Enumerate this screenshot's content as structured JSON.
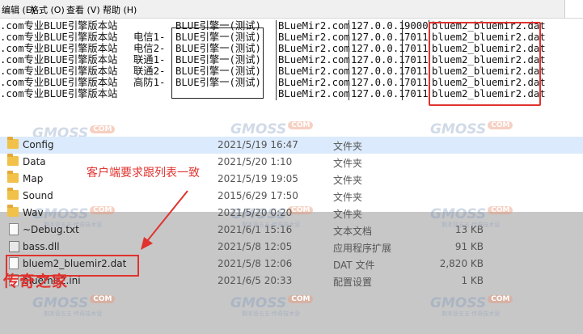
{
  "menu": {
    "items": [
      "编辑 (E)",
      "格式 (O)",
      "查看 (V)",
      "帮助 (H)"
    ]
  },
  "server_list": {
    "rows": [
      {
        "site": ".com专业BLUE引擎版本站",
        "line": "",
        "engine": "BLUE引擎一(测试)",
        "domain": "BLueMir2.com",
        "ip": "127.0.0.1",
        "port": "9000",
        "file": "bluem2_bluemir2.dat"
      },
      {
        "site": ".com专业BLUE引擎版本站",
        "line": "电信1-",
        "engine": "BLUE引擎一(测试)",
        "domain": "BLueMir2.com",
        "ip": "127.0.0.1",
        "port": "7011",
        "file": "bluem2_bluemir2.dat"
      },
      {
        "site": ".com专业BLUE引擎版本站",
        "line": "电信2-",
        "engine": "BLUE引擎一(测试)",
        "domain": "BLueMir2.com",
        "ip": "127.0.0.1",
        "port": "7011",
        "file": "bluem2_bluemir2.dat"
      },
      {
        "site": ".com专业BLUE引擎版本站",
        "line": "联通1-",
        "engine": "BLUE引擎一(测试)",
        "domain": "BLueMir2.com",
        "ip": "127.0.0.1",
        "port": "7011",
        "file": "bluem2_bluemir2.dat"
      },
      {
        "site": ".com专业BLUE引擎版本站",
        "line": "联通2-",
        "engine": "BLUE引擎一(测试)",
        "domain": "BLueMir2.com",
        "ip": "127.0.0.1",
        "port": "7011",
        "file": "bluem2_bluemir2.dat"
      },
      {
        "site": ".com专业BLUE引擎版本站",
        "line": "高防1-",
        "engine": "BLUE引擎一(测试)",
        "domain": "BLueMir2.com",
        "ip": "127.0.0.1",
        "port": "7011",
        "file": "bluem2_bluemir2.dat"
      },
      {
        "site": ".com专业BLUE引擎版本站",
        "line": "",
        "engine": "",
        "domain": "BLueMir2.com",
        "ip": "127.0.0.1",
        "port": "7011",
        "file": "bluem2_bluemir2.dat"
      }
    ]
  },
  "files": [
    {
      "name": "Config",
      "date": "2021/5/19 16:47",
      "type": "文件夹",
      "size": "",
      "icon": "folder-icon",
      "selected": true
    },
    {
      "name": "Data",
      "date": "2021/5/20 1:10",
      "type": "文件夹",
      "size": "",
      "icon": "folder-icon",
      "selected": false
    },
    {
      "name": "Map",
      "date": "2021/5/19 19:05",
      "type": "文件夹",
      "size": "",
      "icon": "folder-icon",
      "selected": false
    },
    {
      "name": "Sound",
      "date": "2015/6/29 17:50",
      "type": "文件夹",
      "size": "",
      "icon": "folder-icon",
      "selected": false
    },
    {
      "name": "Wav",
      "date": "2021/5/20 0:20",
      "type": "文件夹",
      "size": "",
      "icon": "folder-icon",
      "selected": false
    },
    {
      "name": "~Debug.txt",
      "date": "2021/6/1 15:16",
      "type": "文本文档",
      "size": "13 KB",
      "icon": "text-file-icon",
      "selected": false
    },
    {
      "name": "bass.dll",
      "date": "2021/5/8 12:05",
      "type": "应用程序扩展",
      "size": "91 KB",
      "icon": "dll-file-icon",
      "selected": false
    },
    {
      "name": "bluem2_bluemir2.dat",
      "date": "2021/5/8 12:06",
      "type": "DAT 文件",
      "size": "2,820 KB",
      "icon": "dat-file-icon",
      "selected": false
    },
    {
      "name": "bluemir2.ini",
      "date": "2021/6/5 20:33",
      "type": "配置设置",
      "size": "1 KB",
      "icon": "ini-file-icon",
      "selected": false
    }
  ],
  "annotation": {
    "note": "客户端要求跟列表一致",
    "brand": "传奇之家"
  },
  "watermark": {
    "logo": "GMOSS",
    "badge": "COM",
    "tagline": "剩本营五五·传奇技术营"
  },
  "colors": {
    "highlight": "#e0332f",
    "selection": "#dbeafc",
    "folder": "#f1c14a"
  }
}
